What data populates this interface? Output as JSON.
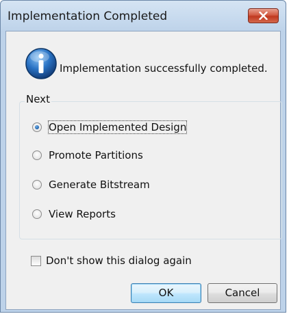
{
  "window": {
    "title": "Implementation Completed"
  },
  "message": "Implementation successfully completed.",
  "next_group": {
    "label": "Next",
    "options": [
      {
        "label": "Open Implemented Design",
        "selected": true
      },
      {
        "label": "Promote Partitions",
        "selected": false
      },
      {
        "label": "Generate Bitstream",
        "selected": false
      },
      {
        "label": "View Reports",
        "selected": false
      }
    ]
  },
  "dont_show": {
    "label": "Don't show this dialog again",
    "checked": false
  },
  "buttons": {
    "ok": "OK",
    "cancel": "Cancel"
  },
  "icons": {
    "title_close": "close-icon",
    "info": "information-icon"
  },
  "colors": {
    "close_button": "#c7432a",
    "info_icon": "#1f5fa8",
    "client_bg": "#f0f0f0"
  }
}
